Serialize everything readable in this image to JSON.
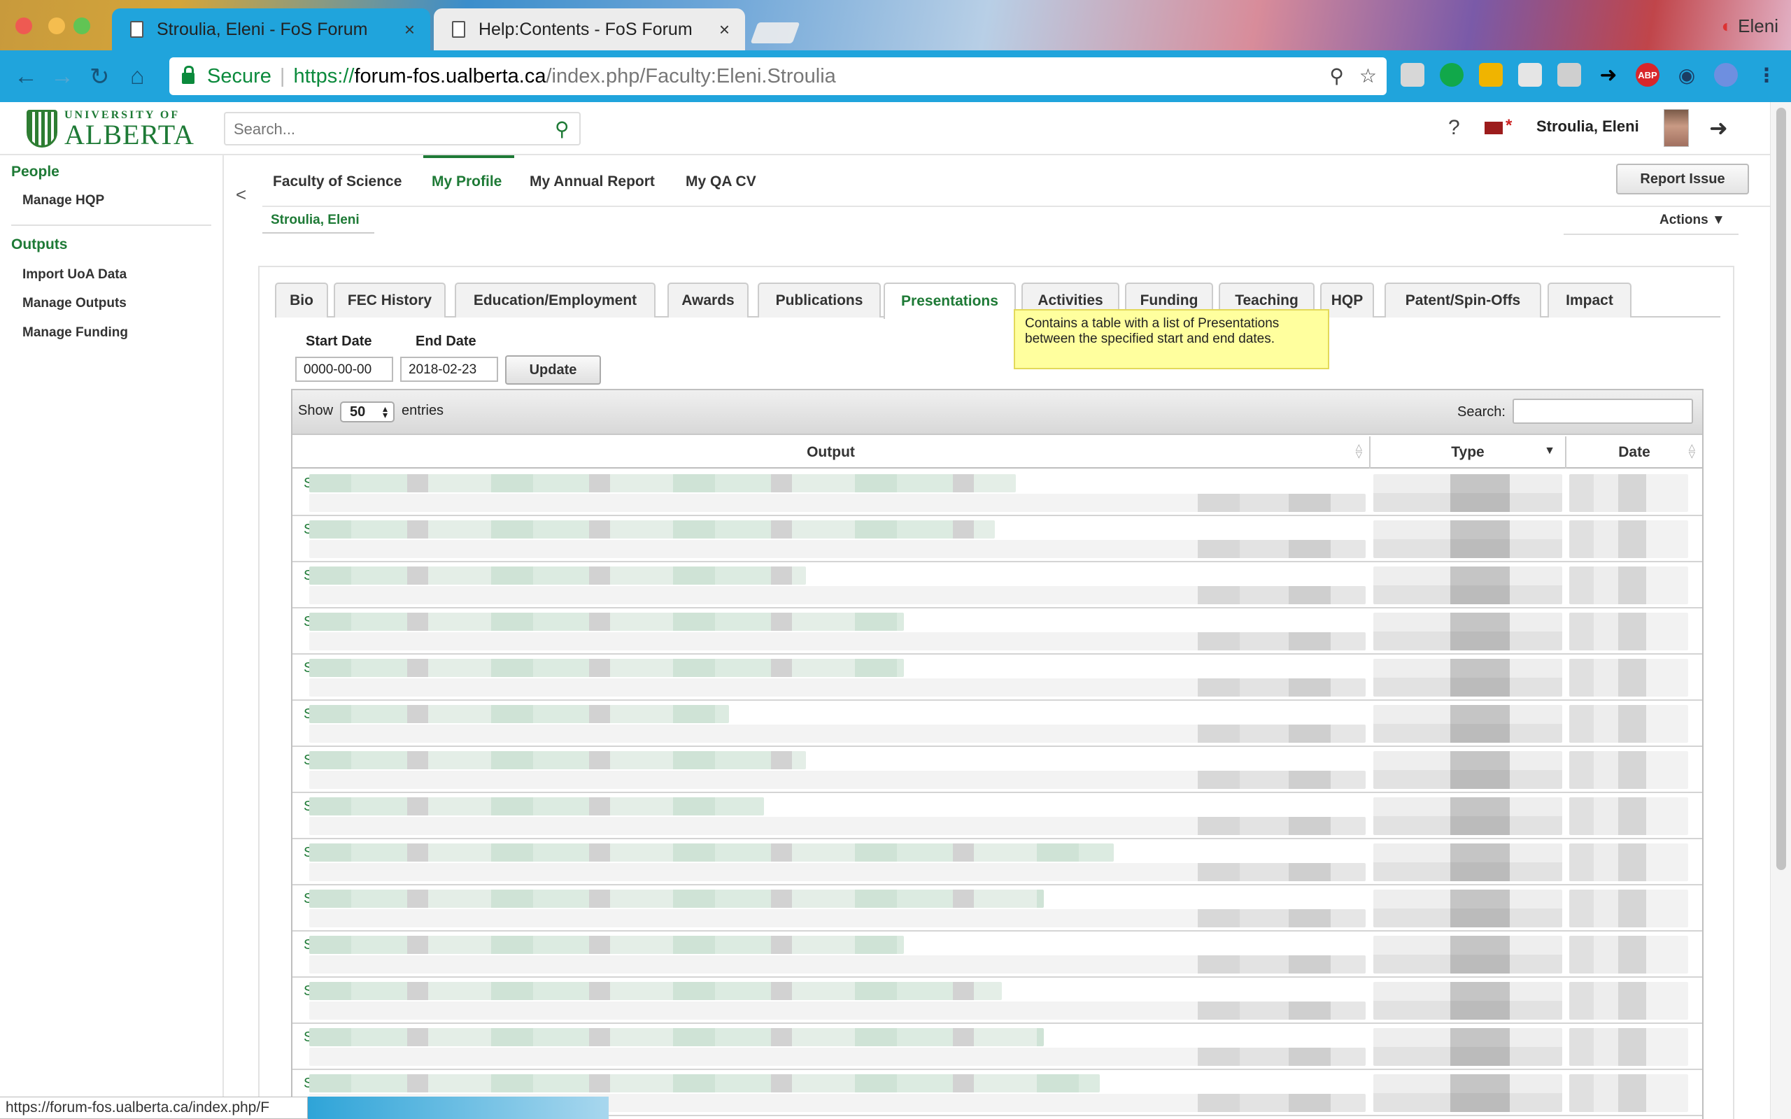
{
  "browser": {
    "tabs": [
      {
        "title": "Stroulia, Eleni - FoS Forum",
        "close": "×"
      },
      {
        "title": "Help:Contents - FoS Forum",
        "close": "×"
      }
    ],
    "profile": "Eleni",
    "secure_label": "Secure",
    "url_proto": "https://",
    "url_host": "forum-fos.ualberta.ca",
    "url_path": "/index.php/Faculty:Eleni.Stroulia",
    "extensions": [
      "ABP"
    ],
    "status_url": "https://forum-fos.ualberta.ca/index.php/F"
  },
  "header": {
    "logo_small": "UNIVERSITY OF",
    "logo_big": "ALBERTA",
    "search_placeholder": "Search...",
    "help": "?",
    "user": "Stroulia, Eleni"
  },
  "sidebar": {
    "sections": [
      {
        "title": "People",
        "items": [
          "Manage HQP"
        ]
      },
      {
        "title": "Outputs",
        "items": [
          "Import UoA Data",
          "Manage Outputs",
          "Manage Funding"
        ]
      }
    ]
  },
  "topnav": {
    "collapse": "<",
    "items": [
      "Faculty of Science",
      "My Profile",
      "My Annual Report",
      "My QA CV"
    ],
    "active": "My Profile",
    "report_issue": "Report Issue",
    "sub_name": "Stroulia, Eleni",
    "actions": "Actions ▼"
  },
  "profile_tabs": {
    "items": [
      "Bio",
      "FEC History",
      "Education/Employment",
      "Awards",
      "Publications",
      "Presentations",
      "Activities",
      "Funding",
      "Teaching",
      "HQP",
      "Patent/Spin-Offs",
      "Impact"
    ],
    "active": "Presentations",
    "tooltip": "Contains a table with a list of Presentations between the specified start and end dates."
  },
  "filters": {
    "start_label": "Start Date",
    "start_value": "0000-00-00",
    "end_label": "End Date",
    "end_value": "2018-02-23",
    "update": "Update"
  },
  "table": {
    "show_label": "Show",
    "page_size": "50",
    "entries_label": "entries",
    "search_label": "Search:",
    "columns": [
      "Output",
      "Type",
      "Date"
    ],
    "row_lead": "S",
    "row_count": 14
  }
}
